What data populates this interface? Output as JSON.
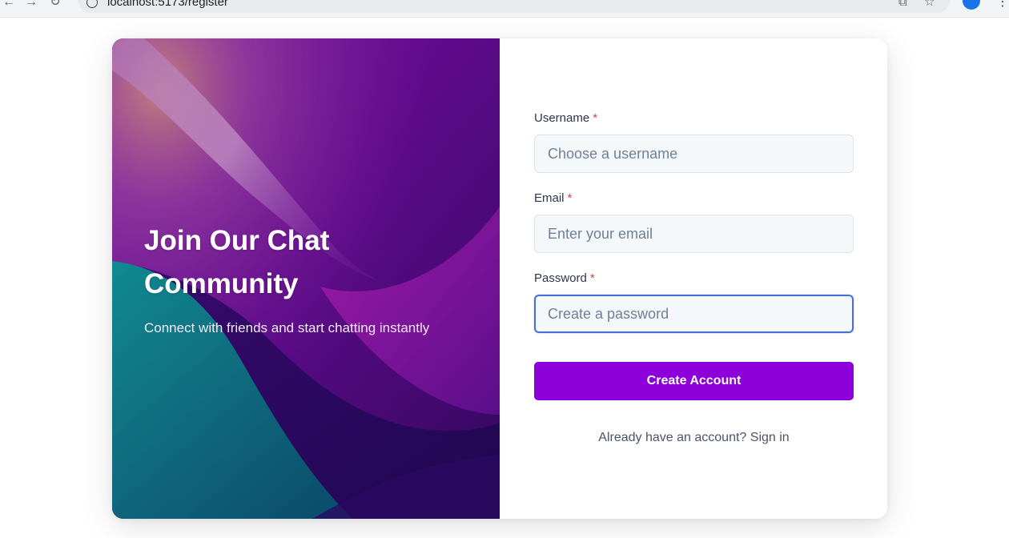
{
  "browser": {
    "url": "localhost:5173/register",
    "icons": [
      "back-arrow-icon",
      "forward-arrow-icon",
      "reload-icon",
      "site-info-icon",
      "translate-icon",
      "bookmark-star-icon",
      "profile-avatar",
      "more-menu-icon"
    ]
  },
  "hero": {
    "title": "Join Our Chat Community",
    "subtitle": "Connect with friends and start chatting instantly"
  },
  "form": {
    "username": {
      "label": "Username",
      "required_mark": "*",
      "placeholder": "Choose a username",
      "value": ""
    },
    "email": {
      "label": "Email",
      "required_mark": "*",
      "placeholder": "Enter your email",
      "value": ""
    },
    "password": {
      "label": "Password",
      "required_mark": "*",
      "placeholder": "Create a password",
      "value": "",
      "focused": true
    },
    "submit_label": "Create Account",
    "signin_prompt": "Already have an account?",
    "signin_link": "Sign in"
  },
  "colors": {
    "accent": "#8e00d9",
    "required": "#e53e3e",
    "focus_ring": "#4a6fd4",
    "hero_purple": "#4a0a78",
    "hero_teal": "#0f6f7e"
  }
}
